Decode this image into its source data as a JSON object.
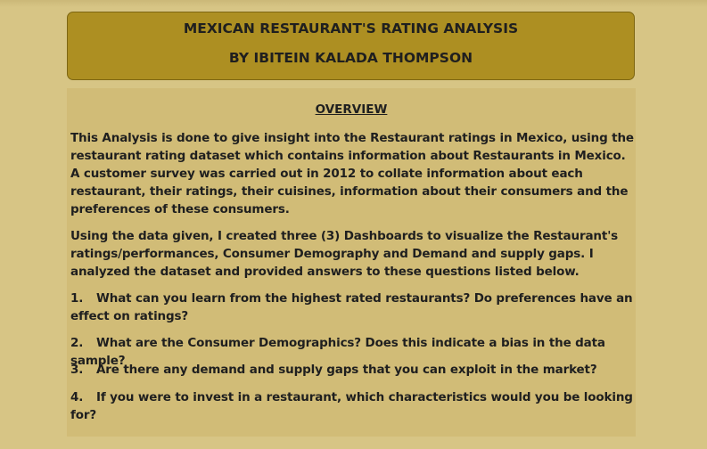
{
  "header": {
    "title_line1": "MEXICAN RESTAURANT'S RATING ANALYSIS",
    "title_line2": "BY IBITEIN KALADA THOMPSON"
  },
  "overview": {
    "heading": "OVERVIEW",
    "paragraph1": "This Analysis is done to give insight into the Restaurant ratings in Mexico, using the restaurant rating dataset which contains information about Restaurants in Mexico. A customer survey was carried out in 2012 to collate information about each restaurant, their ratings, their cuisines, information about their consumers and the preferences of these consumers.",
    "paragraph2": "Using the data given, I created three (3) Dashboards to visualize the Restaurant's ratings/performances, Consumer Demography and Demand and supply gaps. I analyzed the dataset and provided answers to these questions listed below.",
    "questions": [
      {
        "num": "1.",
        "text": "What can you learn from the highest rated restaurants? Do preferences have an effect on ratings?"
      },
      {
        "num": "2.",
        "text": "What are the Consumer Demographics? Does this indicate a bias in the data sample?"
      },
      {
        "num": "3.",
        "text": "Are there any demand and supply gaps that you can exploit in the market?"
      },
      {
        "num": "4.",
        "text": "If you were to invest in a  restaurant, which characteristics would you be looking for?"
      }
    ]
  },
  "colors": {
    "page_background": "#d7c585",
    "title_background": "#ad8f22",
    "content_background": "#d1bc77",
    "text": "#1f1f1f"
  }
}
